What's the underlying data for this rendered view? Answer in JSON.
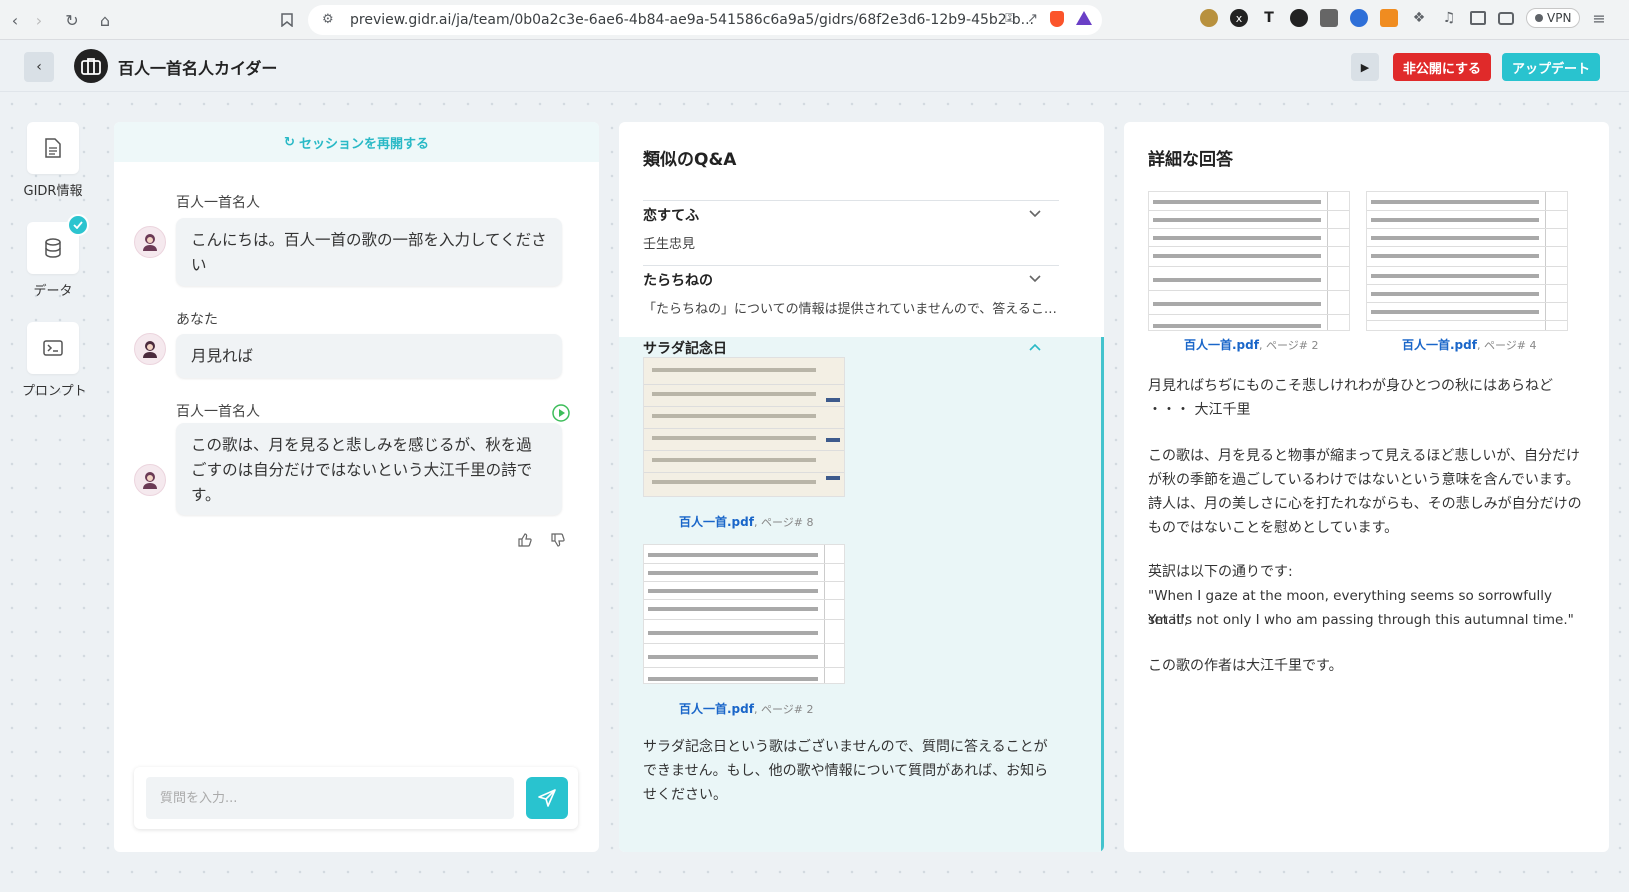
{
  "browser": {
    "url": "preview.gidr.ai/ja/team/0b0a2c3e-6ae6-4b84-ae9a-541586c6a9a5/gidrs/68f2e3d6-12b9-45b2-b...",
    "vpn_label": "VPN"
  },
  "header": {
    "title": "百人一首名人カイダー",
    "unpublish_label": "非公開にする",
    "update_label": "アップデート"
  },
  "rail": {
    "items": [
      {
        "label": "GIDR情報"
      },
      {
        "label": "データ"
      },
      {
        "label": "プロンプト"
      }
    ]
  },
  "chat": {
    "restart_label": "セッションを再開する",
    "messages": [
      {
        "sender": "百人一首名人",
        "text": "こんにちは。百人一首の歌の一部を入力してください"
      },
      {
        "sender": "あなた",
        "text": "月見れば"
      },
      {
        "sender": "百人一首名人",
        "text": "この歌は、月を見ると悲しみを感じるが、秋を過ごすのは自分だけではないという大江千里の詩です。"
      }
    ],
    "input_placeholder": "質問を入力..."
  },
  "qa": {
    "title": "類似のQ&A",
    "items": [
      {
        "title": "恋すてふ",
        "answer": "壬生忠見"
      },
      {
        "title": "たらちねの",
        "answer": "「たらちねの」についての情報は提供されていませんので、答えることが..."
      },
      {
        "title": "サラダ記念日",
        "answer": "サラダ記念日という歌はございませんので、質問に答えることができません。もし、他の歌や情報について質問があれば、お知らせください。"
      }
    ],
    "refs": [
      {
        "file": "百人一首.pdf",
        "page": ", ページ# 8"
      },
      {
        "file": "百人一首.pdf",
        "page": ", ページ# 2"
      }
    ]
  },
  "detail": {
    "title": "詳細な回答",
    "refs": [
      {
        "file": "百人一首.pdf",
        "page": ", ページ# 2"
      },
      {
        "file": "百人一首.pdf",
        "page": ", ページ# 4"
      }
    ],
    "poem_line1": "月見ればちぢにものこそ悲しけれわが身ひとつの秋にはあらねど",
    "poem_line2": "・・・ 大江千里",
    "explanation": "この歌は、月を見ると物事が縮まって見えるほど悲しいが、自分だけが秋の季節を過ごしているわけではないという意味を含んでいます。詩人は、月の美しさに心を打たれながらも、その悲しみが自分だけのものではないことを慰めとしています。",
    "translation_intro": "英訳は以下の通りです:",
    "translation_line1": "\"When I gaze at the moon, everything seems so sorrowfully small,",
    "translation_line2": "Yet it's not only I who am passing through this autumnal time.\"",
    "author_line": "この歌の作者は大江千里です。"
  },
  "colors": {
    "accent": "#29c3cf",
    "danger": "#e02a2a",
    "link": "#1a66c9"
  }
}
